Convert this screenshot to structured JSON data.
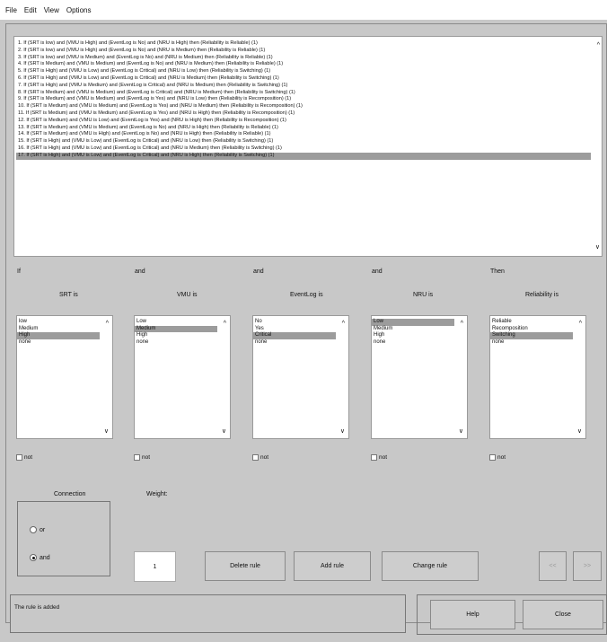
{
  "menu": [
    "File",
    "Edit",
    "View",
    "Options"
  ],
  "rules": [
    "1. If (SRT is low) and (VMU is High) and (EventLog is No) and (NRU is High) then (Reliability is Reliable) (1)",
    "2. If (SRT is low) and (VMU is High) and (EventLog is No) and (NRU is Medium) then (Reliability is Reliable) (1)",
    "3. If (SRT is low) and (VMU is Medium) and (EventLog is No) and (NRU is Medium) then (Reliability is Reliable) (1)",
    "4. If (SRT is Medium) and (VMU is Medium) and (EventLog is No) and (NRU is Medium) then (Reliability is Reliable) (1)",
    "5. If (SRT is High) and (VMU is Low) and (EventLog is Critical) and (NRU is Low) then (Reliability is Switching) (1)",
    "6. If (SRT is High) and (VMU is Low) and (EventLog is Critical) and (NRU is Medium) then (Reliability is Switching) (1)",
    "7. If (SRT is High) and (VMU is Medium) and (EventLog is Critical) and (NRU is Medium) then (Reliability is Switching) (1)",
    "8. If (SRT is Medium) and (VMU is Medium) and (EventLog is Critical) and (NRU is Medium) then (Reliability is Switching) (1)",
    "9. If (SRT is Medium) and (VMU is Medium) and (EventLog is Yes) and (NRU is Low) then (Reliability is Recomposition) (1)",
    "10. If (SRT is Medium) and (VMU is Medium) and (EventLog is Yes) and (NRU is Medium) then (Reliability is Recomposition) (1)",
    "11. If (SRT is Medium) and (VMU is Medium) and (EventLog is Yes) and (NRU is High) then (Reliability is Recomposition) (1)",
    "12. If (SRT is Medium) and (VMU is Low) and (EventLog is Yes) and (NRU is High) then (Reliability is Recomposition) (1)",
    "13. If (SRT is Medium) and (VMU is Medium) and (EventLog is No) and (NRU is High) then (Reliability is Reliable) (1)",
    "14. If (SRT is Medium) and (VMU is High) and (EventLog is No) and (NRU is High) then (Reliability is Reliable) (1)",
    "15. If (SRT is High) and (VMU is Low) and (EventLog is Critical) and (NRU is Low) then (Reliability is Switching) (1)",
    "16. If (SRT is High) and (VMU is Low) and (EventLog is Critical) and (NRU is Medium) then (Reliability is Switching) (1)",
    "17. If (SRT is High) and (VMU is Low) and (EventLog is Critical) and (NRU is High) then (Reliability is Switching) (1)"
  ],
  "selected_rule_index": 16,
  "columns": [
    {
      "prefix": "If",
      "title": "SRT is",
      "options": [
        "low",
        "Medium",
        "High",
        "none"
      ],
      "selected": 2,
      "not_label": "not"
    },
    {
      "prefix": "and",
      "title": "VMU is",
      "options": [
        "Low",
        "Medium",
        "High",
        "none"
      ],
      "selected": 1,
      "not_label": "not"
    },
    {
      "prefix": "and",
      "title": "EventLog is",
      "options": [
        "No",
        "Yes",
        "Critical",
        "none"
      ],
      "selected": 2,
      "not_label": "not"
    },
    {
      "prefix": "and",
      "title": "NRU is",
      "options": [
        "Low",
        "Medium",
        "High",
        "none"
      ],
      "selected": 0,
      "not_label": "not"
    },
    {
      "prefix": "Then",
      "title": "Reliability is",
      "options": [
        "Reliable",
        "Recomposition",
        "Switching",
        "none"
      ],
      "selected": 2,
      "not_label": "not"
    }
  ],
  "connection": {
    "title": "Connection",
    "or_label": "or",
    "and_label": "and",
    "selected": "and"
  },
  "weight": {
    "label": "Weight:",
    "value": "1"
  },
  "buttons": {
    "delete_rule": "Delete rule",
    "add_rule": "Add rule",
    "change_rule": "Change rule",
    "prev": "<<",
    "next": ">>",
    "help": "Help",
    "close": "Close"
  },
  "status": "The rule is added"
}
